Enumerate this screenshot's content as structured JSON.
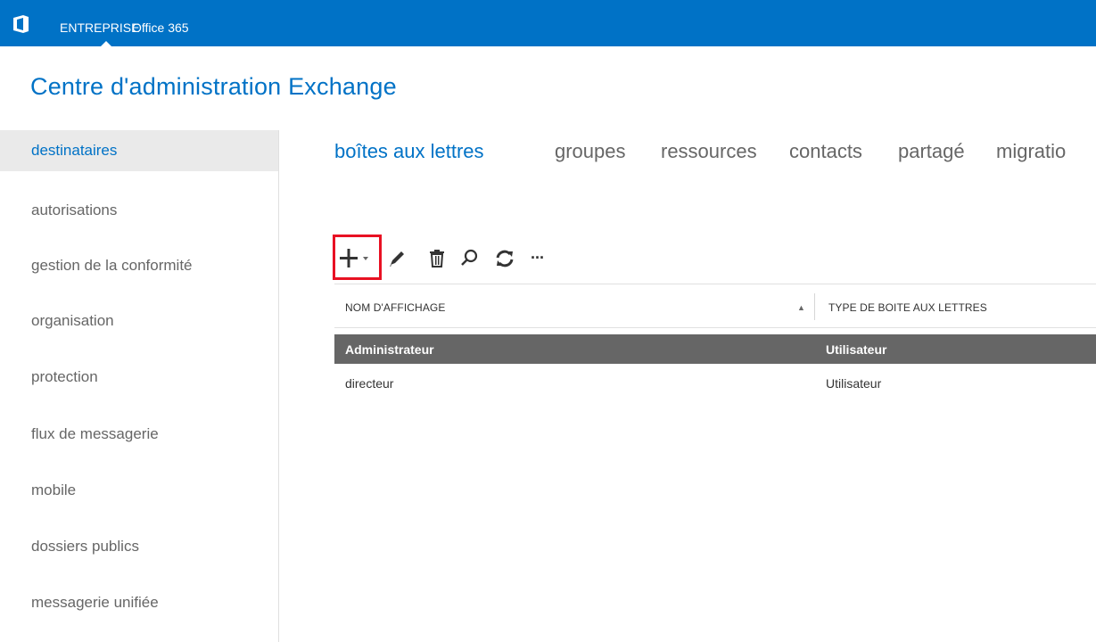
{
  "topbar": {
    "brand": "ENTREPRISE",
    "product": "Office 365",
    "logo_icon": "office-logo-icon",
    "color": "#0072c6"
  },
  "header": {
    "title": "Centre d'administration Exchange"
  },
  "sidebar": {
    "items": [
      {
        "label": "destinataires",
        "active": true
      },
      {
        "label": "autorisations"
      },
      {
        "label": "gestion de la conformité"
      },
      {
        "label": "organisation"
      },
      {
        "label": "protection"
      },
      {
        "label": "flux de messagerie"
      },
      {
        "label": "mobile"
      },
      {
        "label": "dossiers publics"
      },
      {
        "label": "messagerie unifiée"
      }
    ]
  },
  "tabs": [
    {
      "label": "boîtes aux lettres",
      "active": true
    },
    {
      "label": "groupes"
    },
    {
      "label": "ressources"
    },
    {
      "label": "contacts"
    },
    {
      "label": "partagé"
    },
    {
      "label": "migratio"
    }
  ],
  "toolbar": {
    "buttons": [
      "add-icon",
      "edit-icon",
      "delete-icon",
      "search-icon",
      "refresh-icon",
      "more-icon"
    ],
    "more_label": "···"
  },
  "table": {
    "columns": [
      "NOM D'AFFICHAGE",
      "TYPE DE BOITE AUX LETTRES"
    ],
    "rows": [
      {
        "name": "Administrateur",
        "type": "Utilisateur",
        "selected": true
      },
      {
        "name": "directeur",
        "type": "Utilisateur"
      }
    ]
  },
  "colors": {
    "accent": "#0072c6",
    "selection": "#666666",
    "highlight": "#e81123"
  }
}
